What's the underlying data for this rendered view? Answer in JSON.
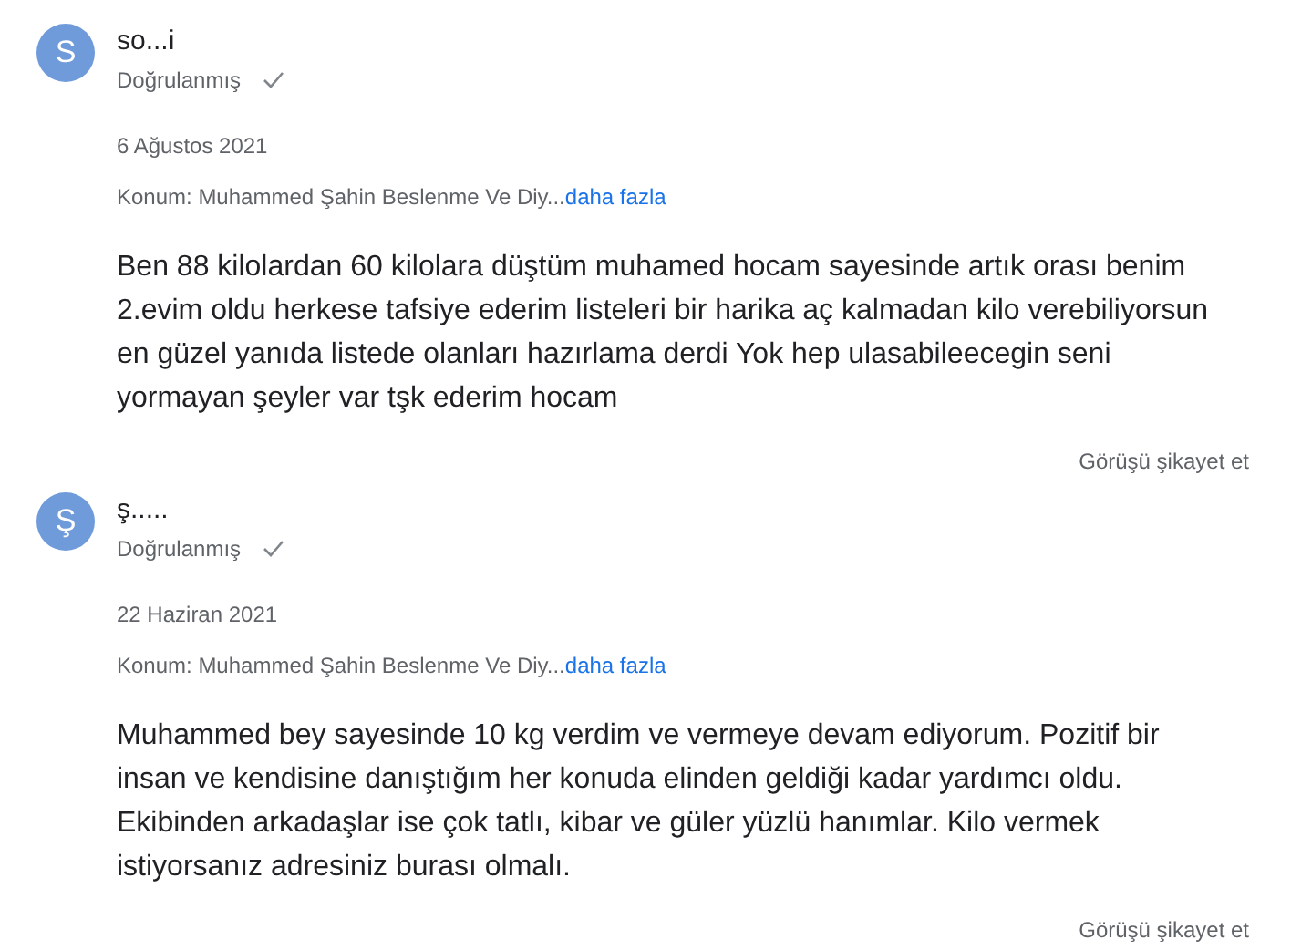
{
  "reviews": [
    {
      "avatar_letter": "S",
      "name": "so...i",
      "verified": true,
      "verified_label": "Doğrulanmış",
      "date": "6 Ağustos 2021",
      "location": "Konum: Muhammed Şahin Beslenme Ve Diy...",
      "more_link": "daha fazla",
      "text": "Ben 88 kilolardan 60 kilolara düştüm muhamed hocam sayesinde artık orası benim 2.evim oldu herkese tafsiye ederim listeleri bir harika aç kalmadan kilo verebiliyorsun en güzel yanıda listede olanları hazırlama derdi Yok hep ulasabileecegin seni yormayan şeyler var tşk ederim hocam",
      "report": "Görüşü şikayet et"
    },
    {
      "avatar_letter": "Ş",
      "name": "ş.....",
      "verified": true,
      "verified_label": "Doğrulanmış",
      "date": "22 Haziran 2021",
      "location": "Konum: Muhammed Şahin Beslenme Ve Diy...",
      "more_link": "daha fazla",
      "text": "Muhammed bey sayesinde 10 kg verdim ve vermeye devam ediyorum. Pozitif bir insan ve kendisine danıştığım her konuda elinden geldiği kadar yardımcı oldu. Ekibinden arkadaşlar ise çok tatlı, kibar ve güler yüzlü hanımlar. Kilo vermek istiyorsanız adresiniz burası olmalı.",
      "report": "Görüşü şikayet et"
    }
  ]
}
